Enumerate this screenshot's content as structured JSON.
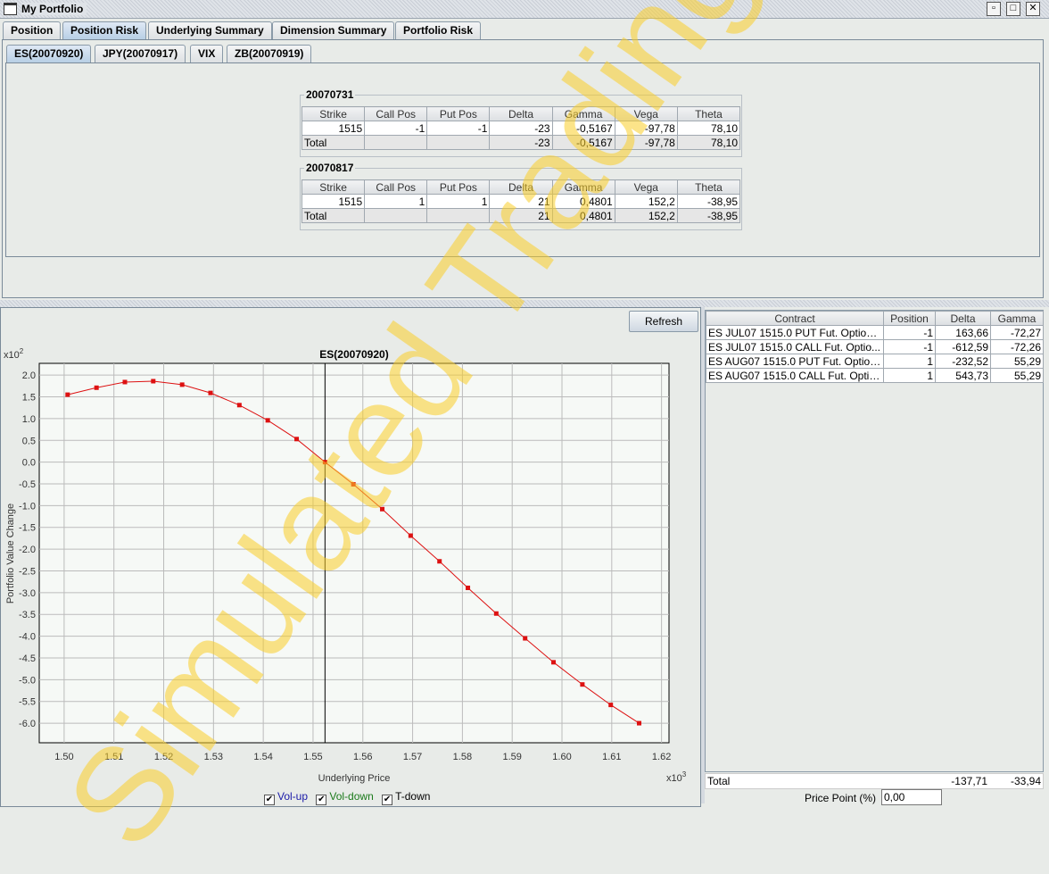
{
  "window": {
    "title": "My Portfolio"
  },
  "main_tabs": [
    {
      "label": "Position"
    },
    {
      "label": "Position Risk"
    },
    {
      "label": "Underlying Summary"
    },
    {
      "label": "Dimension Summary"
    },
    {
      "label": "Portfolio Risk"
    }
  ],
  "sub_tabs": [
    {
      "label": "ES(20070920)"
    },
    {
      "label": "JPY(20070917)"
    },
    {
      "label": "VIX"
    },
    {
      "label": "ZB(20070919)"
    }
  ],
  "risk_columns": [
    "Strike",
    "Call Pos",
    "Put Pos",
    "Delta",
    "Gamma",
    "Vega",
    "Theta"
  ],
  "groups": [
    {
      "title": "20070731",
      "row": [
        "1515",
        "-1",
        "-1",
        "-23",
        "-0,5167",
        "-97,78",
        "78,10"
      ],
      "total": [
        "Total",
        "",
        "",
        "-23",
        "-0,5167",
        "-97,78",
        "78,10"
      ]
    },
    {
      "title": "20070817",
      "row": [
        "1515",
        "1",
        "1",
        "21",
        "0,4801",
        "152,2",
        "-38,95"
      ],
      "total": [
        "Total",
        "",
        "",
        "21",
        "0,4801",
        "152,2",
        "-38,95"
      ]
    }
  ],
  "refresh_label": "Refresh",
  "contracts": {
    "columns": [
      "Contract",
      "Position",
      "Delta",
      "Gamma"
    ],
    "rows": [
      [
        "ES JUL07 1515.0 PUT Fut. Option ...",
        "-1",
        "163,66",
        "-72,27"
      ],
      [
        "ES JUL07 1515.0 CALL Fut. Optio...",
        "-1",
        "-612,59",
        "-72,26"
      ],
      [
        "ES AUG07 1515.0 PUT Fut. Option...",
        "1",
        "-232,52",
        "55,29"
      ],
      [
        "ES AUG07 1515.0 CALL Fut. Optio...",
        "1",
        "543,73",
        "55,29"
      ]
    ],
    "total": [
      "Total",
      "-137,71",
      "-33,94"
    ]
  },
  "price_point": {
    "label": "Price Point (%)",
    "value": "0,00"
  },
  "legend": [
    {
      "label": "Vol-up",
      "color": "#1a1aa8",
      "checked": true
    },
    {
      "label": "Vol-down",
      "color": "#1a7a1a",
      "checked": true
    },
    {
      "label": "T-down",
      "color": "#000000",
      "checked": true
    }
  ],
  "watermark": "Simulated Trading",
  "chart_data": {
    "type": "line",
    "title": "ES(20070920)",
    "xlabel": "Underlying Price",
    "ylabel": "Portfolio Value Change",
    "x_multiplier": "x10^3",
    "y_multiplier": "x10^2",
    "x_mult_base": "x10",
    "x_mult_exp": "3",
    "y_mult_base": "x10",
    "y_mult_exp": "2",
    "xlim": [
      1.495,
      1.6215
    ],
    "ylim": [
      -6.45,
      2.27
    ],
    "xticks": [
      "1.50",
      "1.51",
      "1.52",
      "1.53",
      "1.54",
      "1.55",
      "1.56",
      "1.57",
      "1.58",
      "1.59",
      "1.60",
      "1.61",
      "1.62"
    ],
    "yticks": [
      "2.0",
      "1.5",
      "1.0",
      "0.5",
      "0.0",
      "-0.5",
      "-1.0",
      "-1.5",
      "-2.0",
      "-2.5",
      "-3.0",
      "-3.5",
      "-4.0",
      "-4.5",
      "-5.0",
      "-5.5",
      "-6.0"
    ],
    "current_price": 1.5524,
    "grid": true,
    "line_color": "#dd1111",
    "series": [
      {
        "name": "Portfolio Value",
        "x": [
          1.5007,
          1.5065,
          1.5122,
          1.5179,
          1.5237,
          1.5294,
          1.5352,
          1.5409,
          1.5467,
          1.5524,
          1.5581,
          1.5639,
          1.5696,
          1.5754,
          1.5811,
          1.5868,
          1.5926,
          1.5983,
          1.6041,
          1.6098,
          1.6155
        ],
        "y": [
          1.55,
          1.71,
          1.84,
          1.86,
          1.78,
          1.59,
          1.31,
          0.96,
          0.53,
          0.0,
          -0.51,
          -1.08,
          -1.69,
          -2.28,
          -2.89,
          -3.48,
          -4.05,
          -4.6,
          -5.11,
          -5.58,
          -6.0
        ]
      }
    ]
  }
}
